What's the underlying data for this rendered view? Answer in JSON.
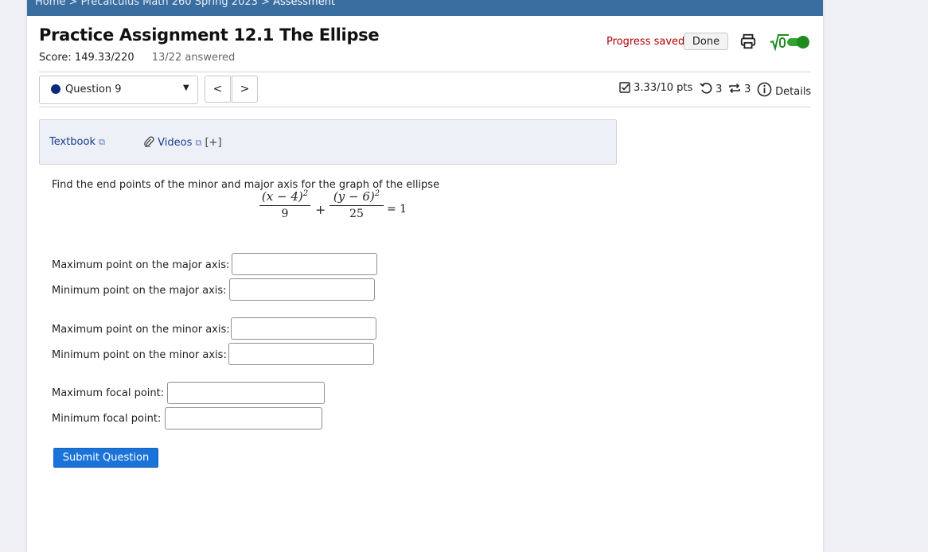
{
  "breadcrumb": {
    "home": "Home",
    "sep1": ">",
    "course": "Precalculus Math 260 Spring 2023",
    "sep2": ">",
    "current": "Assessment"
  },
  "header": {
    "title": "Practice Assignment 12.1 The Ellipse",
    "score": "Score: 149.33/220",
    "answered": "13/22 answered",
    "progress": "Progress saved",
    "done_label": "Done"
  },
  "question_nav": {
    "selected": "Question 9",
    "prev_label": "<",
    "next_label": ">"
  },
  "question_meta": {
    "points": "3.33/10 pts",
    "retries": "3",
    "versions": "3",
    "details": "Details"
  },
  "resources": {
    "textbook": "Textbook",
    "videos": "Videos",
    "expand": "[+]"
  },
  "question": {
    "prompt": "Find the end points of the minor and major axis for the graph of the ellipse",
    "formula": {
      "num1": "(x − 4)",
      "exp1": "2",
      "den1": "9",
      "plus": "+",
      "num2": "(y − 6)",
      "exp2": "2",
      "den2": "25",
      "equals": "= 1"
    }
  },
  "fields": {
    "max_major": "Maximum point on the major axis:",
    "min_major": "Minimum point on the major axis:",
    "max_minor": "Maximum point on the minor axis:",
    "min_minor": "Minimum point on the minor axis:",
    "max_focal": "Maximum focal point:",
    "min_focal": "Minimum focal point:"
  },
  "submit_label": "Submit Question",
  "colors": {
    "breadcrumb_bar": "#3a6ea0",
    "progress_text": "#b00000",
    "toggle_on": "#1f8b1f",
    "submit_button": "#1a73d9"
  },
  "icons": [
    "print-icon",
    "sqrt-icon",
    "toggle-switch",
    "checkbox-icon",
    "retry-icon",
    "versions-icon",
    "info-icon",
    "external-link-icon",
    "paperclip-icon"
  ]
}
